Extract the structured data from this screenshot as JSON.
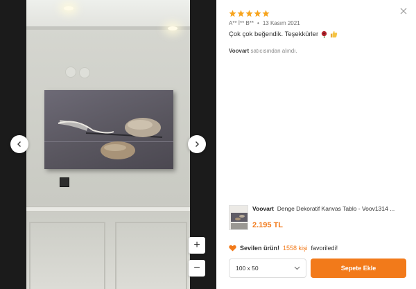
{
  "review": {
    "rating": 5,
    "author": "A** İ** B**",
    "separator": "•",
    "date": "13 Kasım 2021",
    "text": "Çok çok beğendik. Teşekkürler",
    "seller_name": "Voovart",
    "seller_suffix": "satıcısından alındı."
  },
  "product": {
    "brand": "Voovart",
    "name": "Denge Dekoratif Kanvas Tablo - Voov1314 ...",
    "price": "2.195 TL"
  },
  "favorites": {
    "prefix": "Sevilen ürün!",
    "count": "1558 kişi",
    "suffix": "favoriledi!"
  },
  "size_select": {
    "selected": "100 x 50"
  },
  "cart_button": {
    "label": "Sepete Ekle"
  },
  "zoom": {
    "plus": "+",
    "minus": "−"
  },
  "colors": {
    "accent": "#f27a1a",
    "star": "#f7a41d"
  },
  "icons": [
    "close-icon",
    "chevron-left-icon",
    "chevron-right-icon",
    "star-icon",
    "heart-icon",
    "chevron-down-icon",
    "rose-emoji-icon",
    "thumbs-up-emoji-icon"
  ]
}
